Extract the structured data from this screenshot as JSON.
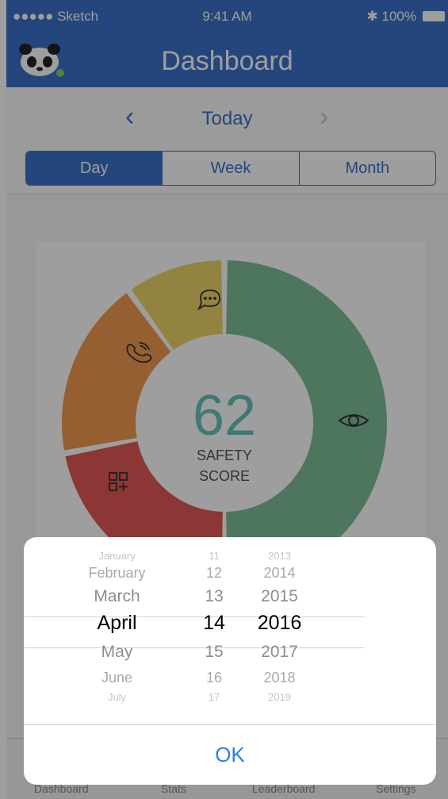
{
  "status": {
    "carrier": "●●●●● Sketch",
    "time": "9:41 AM",
    "battery": "✱ 100%"
  },
  "header": {
    "title": "Dashboard"
  },
  "date_nav": {
    "prev": "‹",
    "label": "Today",
    "next": "›"
  },
  "tabs": [
    "Day",
    "Week",
    "Month"
  ],
  "score": {
    "value": "62",
    "line1": "SAFETY",
    "line2": "SCORE"
  },
  "chart_data": {
    "type": "pie",
    "segments": [
      {
        "icon": "eye-icon",
        "color": "#7fbf9a",
        "share": 0.5
      },
      {
        "icon": "apps-add-icon",
        "color": "#e35a58",
        "share": 0.22
      },
      {
        "icon": "phone-icon",
        "color": "#f19a52",
        "share": 0.18
      },
      {
        "icon": "chat-bubble-icon",
        "color": "#ecd36a",
        "share": 0.1
      }
    ]
  },
  "bottom_tabs": [
    "Dashboard",
    "Stats",
    "Leaderboard",
    "Settings"
  ],
  "picker": {
    "months": [
      "January",
      "February",
      "March",
      "April",
      "May",
      "June",
      "July"
    ],
    "days": [
      "11",
      "12",
      "13",
      "14",
      "15",
      "16",
      "17"
    ],
    "years": [
      "2013",
      "2014",
      "2015",
      "2016",
      "2017",
      "2018",
      "2019"
    ],
    "selected_index": 3
  },
  "ok_label": "OK",
  "colors": {
    "primary": "#3c71c8",
    "ok": "#2f7fe6"
  }
}
